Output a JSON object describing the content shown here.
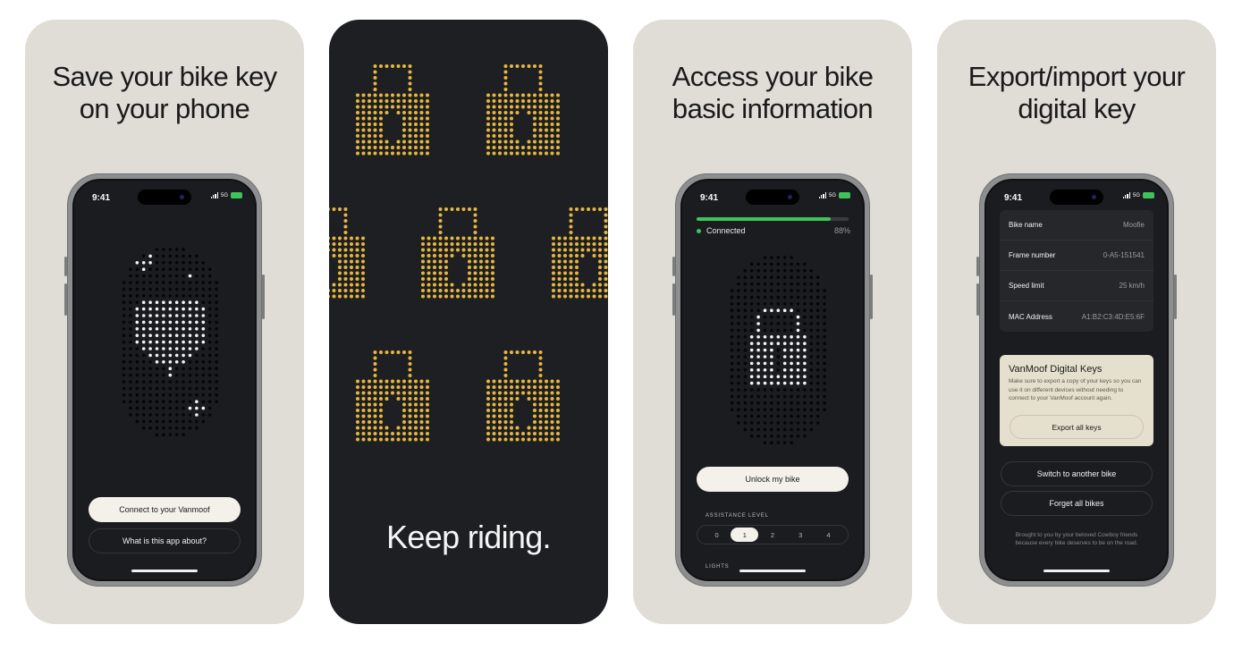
{
  "colors": {
    "card_light": "#dfddd6",
    "card_dark": "#1e1f22",
    "dot_yellow": "#e6b73f",
    "accent_green": "#3fc35a"
  },
  "status_bar": {
    "time": "9:41",
    "network": "5G"
  },
  "panel1": {
    "headline": [
      "Save your bike key",
      "on your phone"
    ],
    "primary_button": "Connect to your Vanmoof",
    "secondary_button": "What is this app about?"
  },
  "panel2": {
    "tagline": "Keep riding."
  },
  "panel3": {
    "headline": [
      "Access your bike",
      "basic information"
    ],
    "connection_status": "Connected",
    "battery_percent": "88%",
    "battery_fraction": 0.88,
    "unlock_button": "Unlock my bike",
    "assistance_label": "ASSISTANCE LEVEL",
    "assistance_levels": [
      "0",
      "1",
      "2",
      "3",
      "4"
    ],
    "assistance_selected": "1",
    "lights_label": "LIGHTS"
  },
  "panel4": {
    "headline": [
      "Export/import your",
      "digital key"
    ],
    "info": [
      {
        "key": "Bike name",
        "value": "Moofie"
      },
      {
        "key": "Frame number",
        "value": "0-A5-151541"
      },
      {
        "key": "Speed limit",
        "value": "25 km/h"
      },
      {
        "key": "MAC Address",
        "value": "A1:B2:C3:4D:E5:6F"
      }
    ],
    "keys_title": "VanMoof Digital Keys",
    "keys_desc": "Make sure to export a copy of your keys so you can use it on different devices without needing to connect to your VanMoof account again.",
    "export_button": "Export all keys",
    "switch_button": "Switch to another bike",
    "forget_button": "Forget all bikes",
    "footer": "Brought to you by your beloved Cowboy friends because every bike deserves to be on the road."
  }
}
